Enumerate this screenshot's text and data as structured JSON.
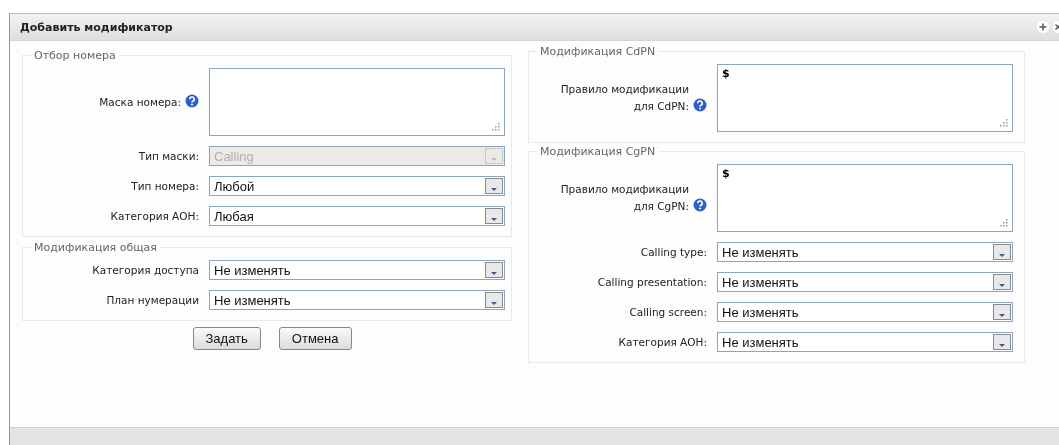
{
  "window": {
    "title": "Добавить модификатор"
  },
  "left_sections": [
    {
      "legend": "Отбор номера",
      "fields": [
        {
          "kind": "textarea",
          "label": "Маска номера:",
          "help": true
        },
        {
          "kind": "select",
          "label": "Тип маски:",
          "value": "Calling",
          "disabled": true
        },
        {
          "kind": "select",
          "label": "Тип номера:",
          "value": "Любой",
          "disabled": false
        },
        {
          "kind": "select",
          "label": "Категория АОН:",
          "value": "Любая",
          "disabled": false
        }
      ]
    },
    {
      "legend": "Модификация общая",
      "fields": [
        {
          "kind": "select",
          "label": "Категория доступа",
          "value": "Не изменять",
          "disabled": false
        },
        {
          "kind": "select",
          "label": "План нумерации",
          "value": "Не изменять",
          "disabled": false
        }
      ]
    }
  ],
  "buttons": [
    "Задать",
    "Отмена"
  ],
  "right_sections": [
    {
      "legend": "Модификация CdPN",
      "fields": [
        {
          "kind": "textarea",
          "label": "Правило модификации для CdPN:",
          "help": true,
          "value": "$"
        }
      ]
    },
    {
      "legend": "Модификация CgPN",
      "fields": [
        {
          "kind": "textarea",
          "label": "Правило модификации для CgPN:",
          "help": true,
          "value": "$"
        },
        {
          "kind": "select",
          "label": "Calling type:",
          "value": "Не изменять",
          "disabled": false
        },
        {
          "kind": "select",
          "label": "Calling presentation:",
          "value": "Не изменять",
          "disabled": false
        },
        {
          "kind": "select",
          "label": "Calling screen:",
          "value": "Не изменять",
          "disabled": false
        },
        {
          "kind": "select",
          "label": "Категория АОН:",
          "value": "Не изменять",
          "disabled": false
        }
      ]
    }
  ]
}
